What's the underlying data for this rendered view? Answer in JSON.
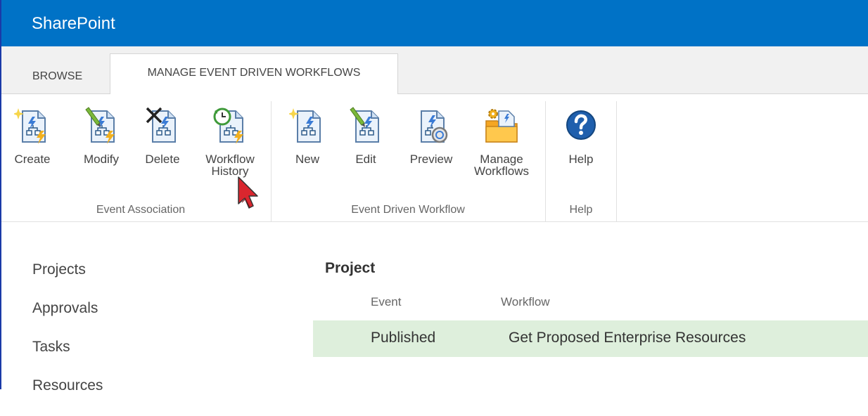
{
  "app": {
    "brand": "SharePoint"
  },
  "tabs": [
    {
      "label": "BROWSE"
    },
    {
      "label": "MANAGE EVENT DRIVEN WORKFLOWS"
    }
  ],
  "ribbon": {
    "groups": [
      {
        "label": "Event Association",
        "buttons": [
          {
            "label": "Create",
            "icon": "workflow-new-sparkle-icon"
          },
          {
            "label": "Modify",
            "icon": "workflow-edit-pencil-icon"
          },
          {
            "label": "Delete",
            "icon": "workflow-delete-x-icon"
          },
          {
            "label": "Workflow History",
            "icon": "workflow-history-clock-icon"
          }
        ]
      },
      {
        "label": "Event Driven Workflow",
        "buttons": [
          {
            "label": "New",
            "icon": "workflow-new-icon"
          },
          {
            "label": "Edit",
            "icon": "workflow-edit-icon"
          },
          {
            "label": "Preview",
            "icon": "workflow-preview-icon"
          },
          {
            "label": "Manage Workflows",
            "icon": "manage-workflows-folder-icon"
          }
        ]
      },
      {
        "label": "Help",
        "buttons": [
          {
            "label": "Help",
            "icon": "help-question-icon"
          }
        ]
      }
    ]
  },
  "nav": {
    "items": [
      "Projects",
      "Approvals",
      "Tasks",
      "Resources"
    ]
  },
  "content": {
    "section_title": "Project",
    "columns": [
      "Event",
      "Workflow"
    ],
    "rows": [
      {
        "event": "Published",
        "workflow": "Get Proposed Enterprise Resources"
      }
    ]
  },
  "colors": {
    "suite_bar": "#0072c6",
    "tab_strip": "#f1f1f1",
    "row_highlight": "#deefdc"
  }
}
